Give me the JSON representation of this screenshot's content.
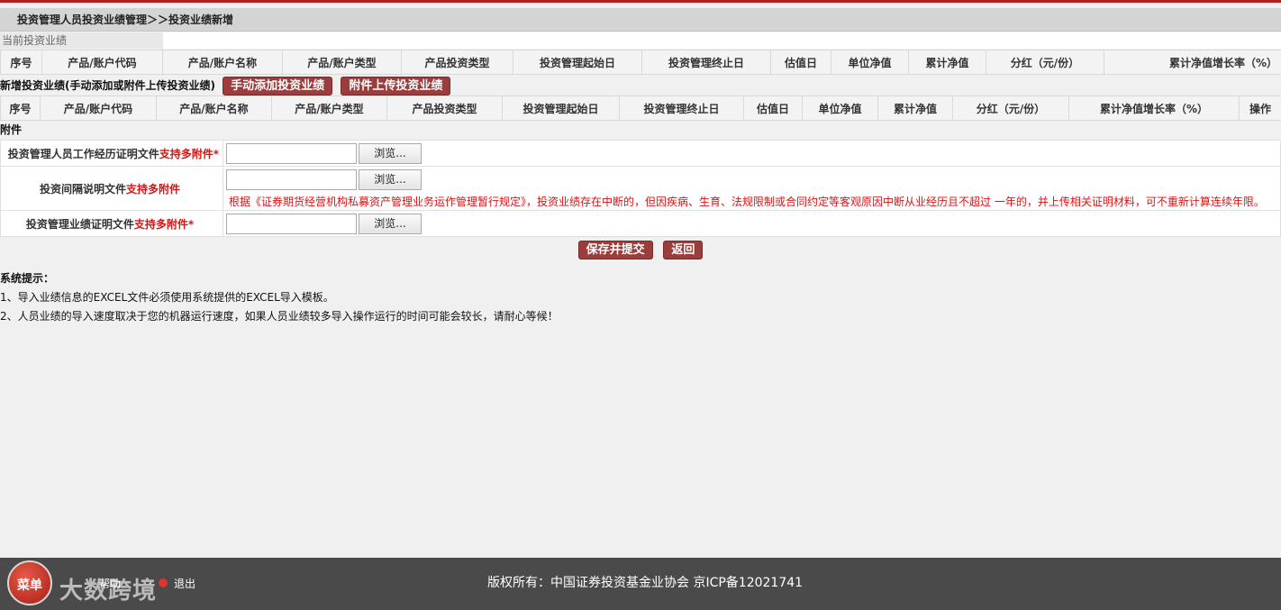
{
  "breadcrumb": "投资管理人员投资业绩管理＞＞投资业绩新增",
  "current_section": {
    "title": "当前投资业绩"
  },
  "perf_table": {
    "headers": [
      "序号",
      "产品/账户代码",
      "产品/账户名称",
      "产品/账户类型",
      "产品投资类型",
      "投资管理起始日",
      "投资管理终止日",
      "估值日",
      "单位净值",
      "累计净值",
      "分红（元/份）",
      "累计净值增长率（%）"
    ]
  },
  "new_section": {
    "label": "新增投资业绩(手动添加或附件上传投资业绩)",
    "manual_add_btn": "手动添加投资业绩",
    "upload_btn": "附件上传投资业绩"
  },
  "new_table": {
    "headers": [
      "序号",
      "产品/账户代码",
      "产品/账户名称",
      "产品/账户类型",
      "产品投资类型",
      "投资管理起始日",
      "投资管理终止日",
      "估值日",
      "单位净值",
      "累计净值",
      "分红（元/份）",
      "累计净值增长率（%）",
      "操作"
    ]
  },
  "attachments": {
    "title": "附件",
    "rows": [
      {
        "label": "投资管理人员工作经历证明文件",
        "tag": "支持多附件*",
        "browse": "浏览..."
      },
      {
        "label": "投资间隔说明文件",
        "tag": "支持多附件",
        "browse": "浏览...",
        "note": "根据《证券期货经营机构私募资产管理业务运作管理暂行规定》，投资业绩存在中断的，但因疾病、生育、法规限制或合同约定等客观原因中断从业经历且不超过 一年的，并上传相关证明材料，可不重新计算连续年限。"
      },
      {
        "label": "投资管理业绩证明文件",
        "tag": "支持多附件*",
        "browse": "浏览..."
      }
    ]
  },
  "actions": {
    "submit": "保存并提交",
    "back": "返回"
  },
  "tips": {
    "title": "系统提示：",
    "lines": [
      "1、导入业绩信息的EXCEL文件必须使用系统提供的EXCEL导入模板。",
      "2、人员业绩的导入速度取决于您的机器运行速度，如果人员业绩较多导入操作运行的时间可能会较长，请耐心等候！"
    ]
  },
  "footer": {
    "menu": "菜单",
    "watermark": "大数跨境",
    "help": "帮助",
    "logout": "退出",
    "copyright": "版权所有：中国证券投资基金业协会 京ICP备12021741"
  },
  "colors": {
    "accent": "#9b3d3d",
    "topline": "#b01e1e",
    "required": "#d81414",
    "footer_bg": "#4a4a4a"
  }
}
